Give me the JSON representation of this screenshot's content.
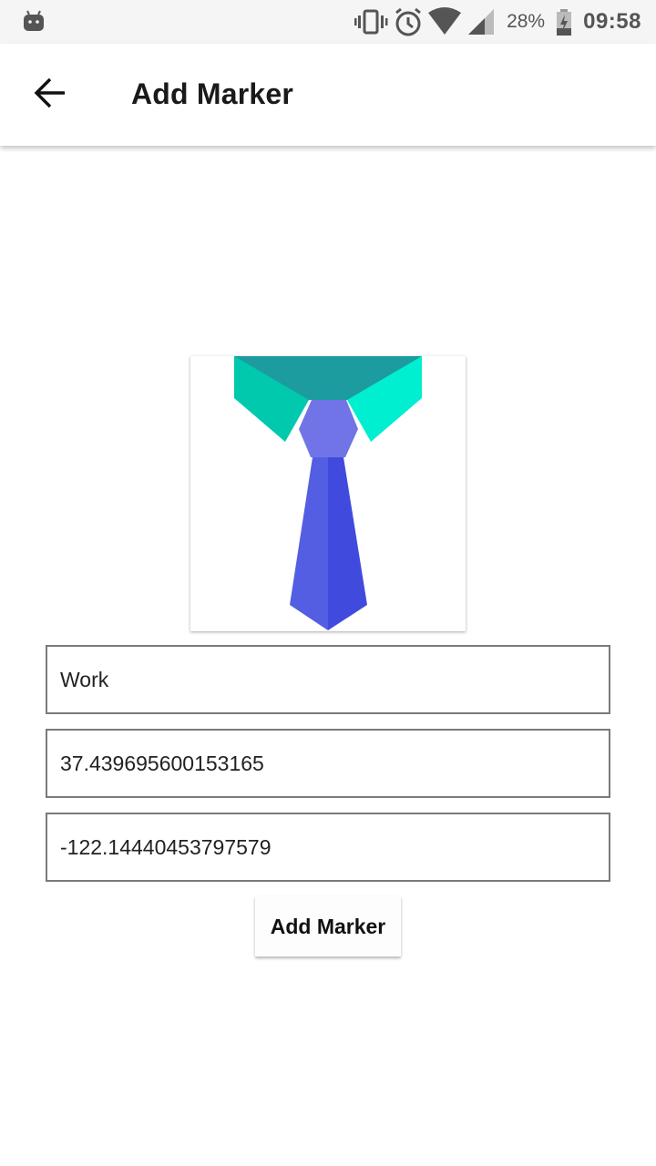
{
  "status_bar": {
    "battery_percent": "28%",
    "time": "09:58",
    "icons": [
      "android-robot-icon",
      "vibrate-icon",
      "alarm-icon",
      "wifi-icon",
      "cell-signal-icon",
      "battery-charging-icon"
    ]
  },
  "app_bar": {
    "title": "Add Marker",
    "back_icon": "arrow-back-icon"
  },
  "marker_image": {
    "icon": "tie-icon",
    "colors": {
      "collar_left": "#00c9ad",
      "collar_right": "#00efd0",
      "collar_top": "#1c9c9f",
      "knot": "#7074e6",
      "tie_left": "#545ee2",
      "tie_right": "#404bde"
    }
  },
  "form": {
    "name_value": "Work",
    "latitude_value": "37.439695600153165",
    "longitude_value": "-122.14440453797579",
    "submit_label": "Add Marker"
  }
}
